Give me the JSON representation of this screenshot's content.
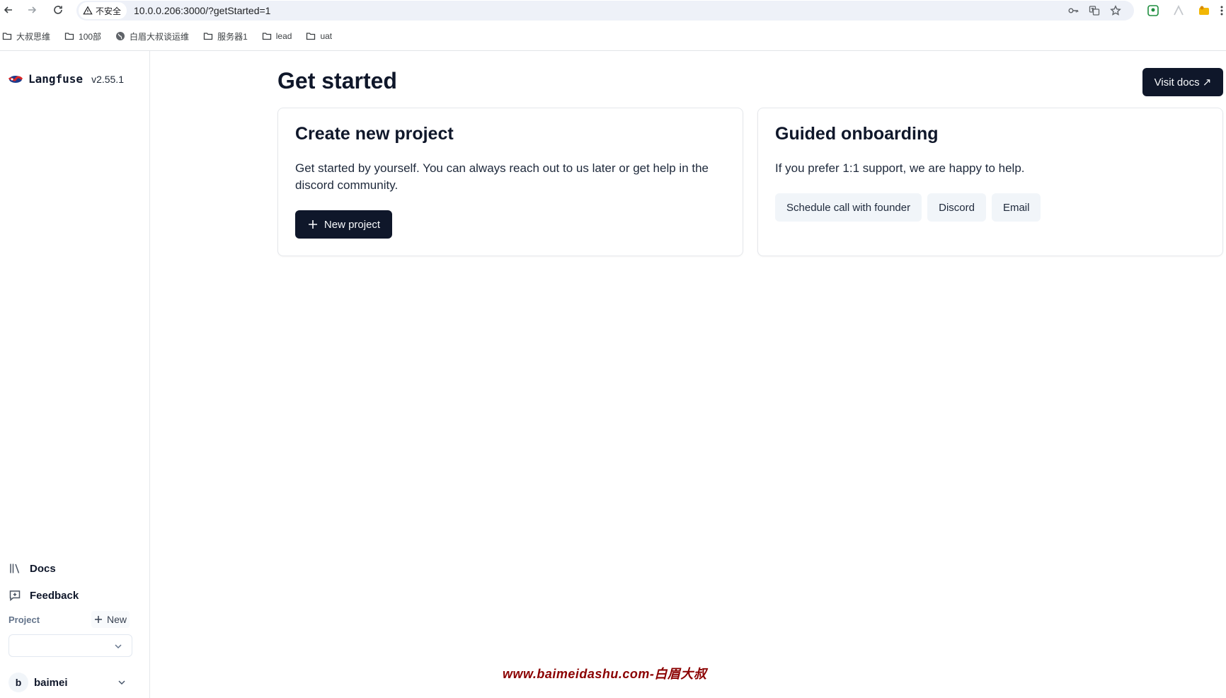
{
  "browser": {
    "security_label": "不安全",
    "url": "10.0.0.206:3000/?getStarted=1",
    "bookmarks": [
      "大叔思维",
      "100部",
      "白眉大叔谈运维",
      "服务器1",
      "lead",
      "uat"
    ]
  },
  "sidebar": {
    "brand_name": "Langfuse",
    "version": "v2.55.1",
    "docs_label": "Docs",
    "feedback_label": "Feedback",
    "project_label": "Project",
    "new_label": "New",
    "project_selected": "",
    "user_initial": "b",
    "user_name": "baimei"
  },
  "main": {
    "title": "Get started",
    "visit_docs_label": "Visit docs ↗",
    "create_card": {
      "title": "Create new project",
      "description": "Get started by yourself. You can always reach out to us later or get help in the discord community.",
      "button_label": "New project"
    },
    "guided_card": {
      "title": "Guided onboarding",
      "description": "If you prefer 1:1 support, we are happy to help.",
      "buttons": [
        "Schedule call with founder",
        "Discord",
        "Email"
      ]
    }
  },
  "watermark": "www.baimeidashu.com-白眉大叔",
  "colors": {
    "primary": "#0f172a",
    "secondary_bg": "#f1f5f9",
    "watermark": "#8b0000"
  }
}
